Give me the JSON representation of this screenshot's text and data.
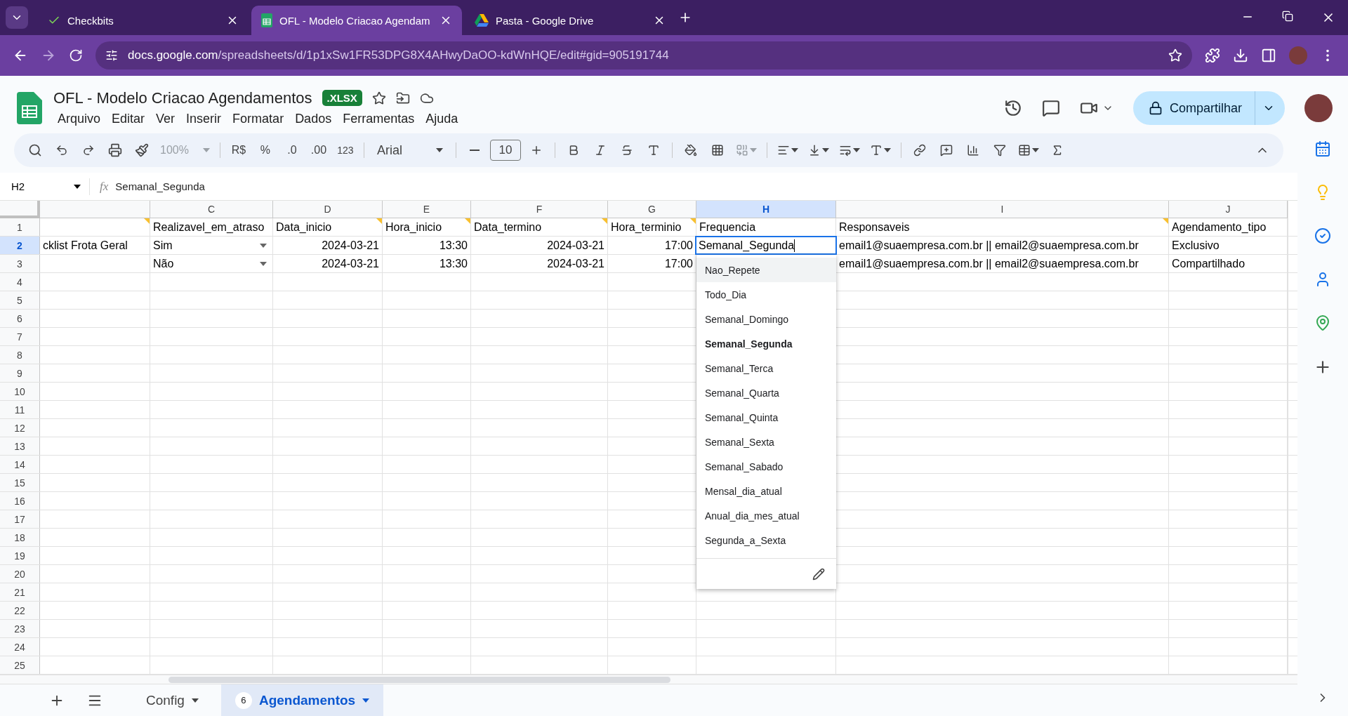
{
  "browser": {
    "tabs": [
      {
        "title": "Checkbits",
        "kind": "check",
        "selected": false
      },
      {
        "title": "OFL - Modelo Criacao Agendam",
        "kind": "sheets",
        "selected": true
      },
      {
        "title": "Pasta - Google Drive",
        "kind": "drive",
        "selected": false
      }
    ],
    "url": {
      "domain": "docs.google.com",
      "path": "/spreadsheets/d/1p1xSw1FR53DPG8X4AHwyDaOO-kdWnHQE/edit#gid=905191744"
    }
  },
  "document": {
    "title": "OFL - Modelo Criacao Agendamentos",
    "badge": ".XLSX",
    "menu": [
      "Arquivo",
      "Editar",
      "Ver",
      "Inserir",
      "Formatar",
      "Dados",
      "Ferramentas",
      "Ajuda"
    ],
    "share": "Compartilhar"
  },
  "toolbar": {
    "zoom": "100%",
    "currency": "R$",
    "percent": "%",
    "decimal_decrease": ".0",
    "decimal_increase": ".00",
    "number_format": "123",
    "font": "Arial",
    "font_size": "10"
  },
  "formula_bar": {
    "cell": "H2",
    "label": "fx",
    "value": "Semanal_Segunda"
  },
  "columns": [
    {
      "selected": false
    },
    {
      "letter": "C",
      "selected": false
    },
    {
      "letter": "D",
      "selected": false
    },
    {
      "letter": "E",
      "selected": false
    },
    {
      "letter": "F",
      "selected": false
    },
    {
      "letter": "G",
      "selected": false
    },
    {
      "letter": "H",
      "selected": true
    },
    {
      "letter": "I",
      "selected": false
    },
    {
      "letter": "J",
      "selected": false
    }
  ],
  "rows": [
    {
      "number": "1",
      "selected": false,
      "cells": [
        {
          "kind": "empty",
          "note": true
        },
        {
          "text": "Realizavel_em_atraso",
          "kind": "text",
          "note": false
        },
        {
          "text": "Data_inicio",
          "kind": "text",
          "note": true
        },
        {
          "text": "Hora_inicio",
          "kind": "text",
          "note": true
        },
        {
          "text": "Data_termino",
          "kind": "text",
          "note": true
        },
        {
          "text": "Hora_terminio",
          "kind": "text",
          "note": true
        },
        {
          "text": "Frequencia",
          "kind": "text",
          "note": false
        },
        {
          "text": "Responsaveis",
          "kind": "text",
          "note": true
        },
        {
          "text": "Agendamento_tipo",
          "kind": "text",
          "note": false
        }
      ]
    },
    {
      "number": "2",
      "selected": true,
      "cells": [
        {
          "text": "cklist Frota Geral",
          "kind": "text"
        },
        {
          "text": "Sim",
          "kind": "chip"
        },
        {
          "text": "2024-03-21",
          "kind": "number"
        },
        {
          "text": "13:30",
          "kind": "number"
        },
        {
          "text": "2024-03-21",
          "kind": "number"
        },
        {
          "text": "17:00",
          "kind": "number"
        },
        {
          "text": "Semanal_Segunda",
          "kind": "editing"
        },
        {
          "text": "email1@suaempresa.com.br || email2@suaempresa.com.br",
          "kind": "text"
        },
        {
          "text": "Exclusivo",
          "kind": "text"
        }
      ]
    },
    {
      "number": "3",
      "selected": false,
      "cells": [
        {
          "kind": "empty"
        },
        {
          "text": "Não",
          "kind": "chip"
        },
        {
          "text": "2024-03-21",
          "kind": "number"
        },
        {
          "text": "13:30",
          "kind": "number"
        },
        {
          "text": "2024-03-21",
          "kind": "number"
        },
        {
          "text": "17:00",
          "kind": "number"
        },
        {
          "kind": "empty"
        },
        {
          "text": "email1@suaempresa.com.br || email2@suaempresa.com.br",
          "kind": "text"
        },
        {
          "text": "Compartilhado",
          "kind": "text"
        }
      ]
    },
    {
      "number": "4",
      "selected": false
    },
    {
      "number": "5",
      "selected": false
    },
    {
      "number": "6",
      "selected": false
    },
    {
      "number": "7",
      "selected": false
    },
    {
      "number": "8",
      "selected": false
    },
    {
      "number": "9",
      "selected": false
    },
    {
      "number": "10",
      "selected": false
    },
    {
      "number": "11",
      "selected": false
    },
    {
      "number": "12",
      "selected": false
    },
    {
      "number": "13",
      "selected": false
    },
    {
      "number": "14",
      "selected": false
    },
    {
      "number": "15",
      "selected": false
    },
    {
      "number": "16",
      "selected": false
    },
    {
      "number": "17",
      "selected": false
    },
    {
      "number": "18",
      "selected": false
    },
    {
      "number": "19",
      "selected": false
    },
    {
      "number": "20",
      "selected": false
    },
    {
      "number": "21",
      "selected": false
    },
    {
      "number": "22",
      "selected": false
    },
    {
      "number": "23",
      "selected": false
    },
    {
      "number": "24",
      "selected": false
    },
    {
      "number": "25",
      "selected": false
    }
  ],
  "dropdown": {
    "options": [
      {
        "label": "Nao_Repete",
        "selected": false,
        "highlighted": true
      },
      {
        "label": "Todo_Dia",
        "selected": false,
        "highlighted": false
      },
      {
        "label": "Semanal_Domingo",
        "selected": false,
        "highlighted": false
      },
      {
        "label": "Semanal_Segunda",
        "selected": true,
        "highlighted": false
      },
      {
        "label": "Semanal_Terca",
        "selected": false,
        "highlighted": false
      },
      {
        "label": "Semanal_Quarta",
        "selected": false,
        "highlighted": false
      },
      {
        "label": "Semanal_Quinta",
        "selected": false,
        "highlighted": false
      },
      {
        "label": "Semanal_Sexta",
        "selected": false,
        "highlighted": false
      },
      {
        "label": "Semanal_Sabado",
        "selected": false,
        "highlighted": false
      },
      {
        "label": "Mensal_dia_atual",
        "selected": false,
        "highlighted": false
      },
      {
        "label": "Anual_dia_mes_atual",
        "selected": false,
        "highlighted": false
      },
      {
        "label": "Segunda_a_Sexta",
        "selected": false,
        "highlighted": false
      }
    ]
  },
  "sheets": [
    {
      "name": "Config",
      "selected": false
    },
    {
      "name": "Agendamentos",
      "count": "6",
      "selected": true
    }
  ]
}
